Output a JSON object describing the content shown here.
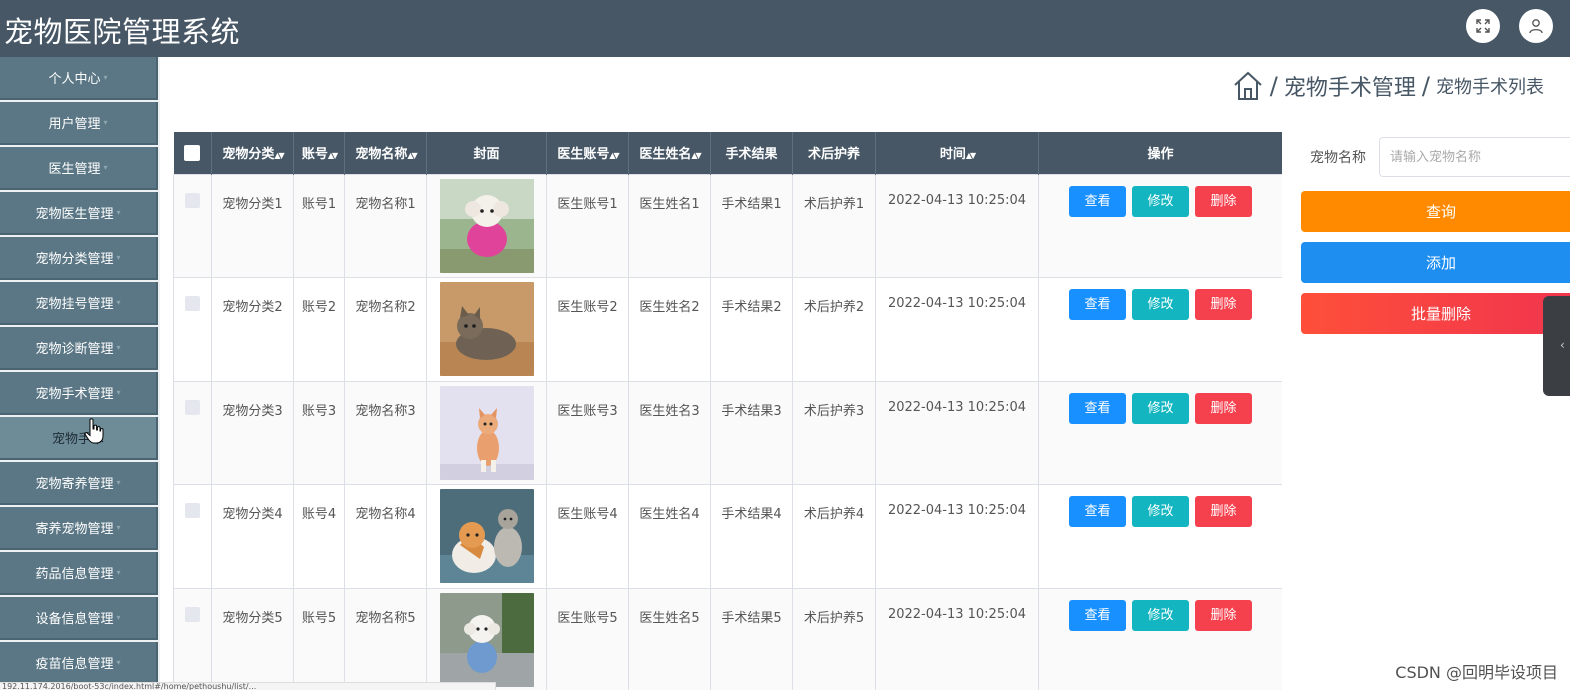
{
  "app": {
    "title": "宠物医院管理系统"
  },
  "topbar": {
    "fullscreen_icon": "fullscreen-icon",
    "user_icon": "user-icon"
  },
  "sidebar": {
    "items": [
      {
        "label": "个人中心"
      },
      {
        "label": "用户管理"
      },
      {
        "label": "医生管理"
      },
      {
        "label": "宠物医生管理"
      },
      {
        "label": "宠物分类管理"
      },
      {
        "label": "宠物挂号管理"
      },
      {
        "label": "宠物诊断管理"
      },
      {
        "label": "宠物手术管理"
      },
      {
        "label": "宠物手术"
      },
      {
        "label": "宠物寄养管理"
      },
      {
        "label": "寄养宠物管理"
      },
      {
        "label": "药品信息管理"
      },
      {
        "label": "设备信息管理"
      },
      {
        "label": "疫苗信息管理"
      }
    ]
  },
  "breadcrumb": {
    "home_icon": "home-icon",
    "separator": "/",
    "section": "宠物手术管理",
    "page": "宠物手术列表"
  },
  "table": {
    "headers": [
      "宠物分类",
      "账号",
      "宠物名称",
      "封面",
      "医生账号",
      "医生姓名",
      "手术结果",
      "术后护养",
      "时间",
      "操作"
    ],
    "sort_glyph": "◆",
    "rows": [
      {
        "category": "宠物分类1",
        "account": "账号1",
        "pet_name": "宠物名称1",
        "doctor_account": "医生账号1",
        "doctor_name": "医生姓名1",
        "result": "手术结果1",
        "care": "术后护养1",
        "time": "2022-04-13 10:25:04"
      },
      {
        "category": "宠物分类2",
        "account": "账号2",
        "pet_name": "宠物名称2",
        "doctor_account": "医生账号2",
        "doctor_name": "医生姓名2",
        "result": "手术结果2",
        "care": "术后护养2",
        "time": "2022-04-13 10:25:04"
      },
      {
        "category": "宠物分类3",
        "account": "账号3",
        "pet_name": "宠物名称3",
        "doctor_account": "医生账号3",
        "doctor_name": "医生姓名3",
        "result": "手术结果3",
        "care": "术后护养3",
        "time": "2022-04-13 10:25:04"
      },
      {
        "category": "宠物分类4",
        "account": "账号4",
        "pet_name": "宠物名称4",
        "doctor_account": "医生账号4",
        "doctor_name": "医生姓名4",
        "result": "手术结果4",
        "care": "术后护养4",
        "time": "2022-04-13 10:25:04"
      },
      {
        "category": "宠物分类5",
        "account": "账号5",
        "pet_name": "宠物名称5",
        "doctor_account": "医生账号5",
        "doctor_name": "医生姓名5",
        "result": "手术结果5",
        "care": "术后护养5",
        "time": "2022-04-13 10:25:04"
      }
    ],
    "actions": {
      "view": "查看",
      "edit": "修改",
      "delete": "删除"
    }
  },
  "search": {
    "label": "宠物名称",
    "placeholder": "请输入宠物名称"
  },
  "buttons": {
    "query": "查询",
    "add": "添加",
    "batch_delete": "批量删除"
  },
  "colors": {
    "topbar": "#475766",
    "sidebar_item": "#5b7785",
    "view": "#1890ff",
    "edit": "#13b6c0",
    "delete": "#f5404e",
    "query": "#ff8a00",
    "add": "#1f8ef1"
  },
  "status_url": "192.11.174.2016/boot-53c/index.html#/home/pethoushu/list/...",
  "watermark": "CSDN @回明毕设项目"
}
